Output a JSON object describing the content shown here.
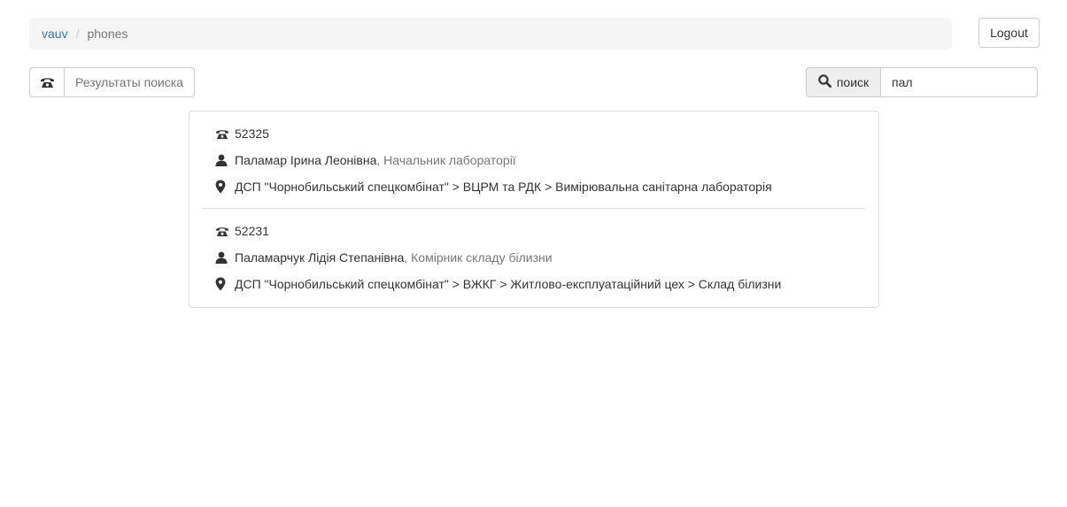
{
  "breadcrumb": {
    "home": "vauv",
    "separator": "/",
    "current": "phones"
  },
  "header": {
    "logout_label": "Logout"
  },
  "results_bar": {
    "icon": "phone-icon",
    "label": "Результаты поиска"
  },
  "search": {
    "button_label": "поиск",
    "icon": "search-icon",
    "value": "пал"
  },
  "entries": [
    {
      "phone": "52325",
      "name": "Паламар Ірина Леонівна",
      "position": ", Начальник лабораторії",
      "location": "ДСП \"Чорнобильський спецкомбінат\" > ВЦРМ та РДК > Вимірювальна санітарна лабораторія"
    },
    {
      "phone": "52231",
      "name": "Паламарчук Лідія Степанівна",
      "position": ", Комірник складу білизни",
      "location": "ДСП \"Чорнобильський спецкомбінат\" > ВЖКГ > Житлово-експлуатаційний цех > Склад білизни"
    }
  ]
}
